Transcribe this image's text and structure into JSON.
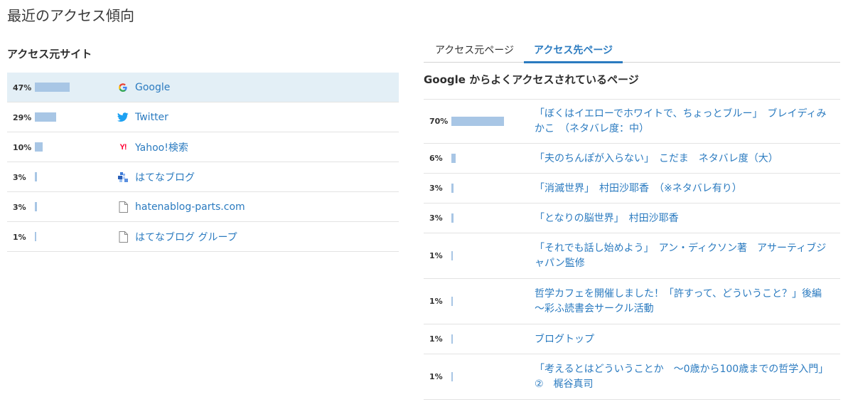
{
  "page_title": "最近のアクセス傾向",
  "left": {
    "title": "アクセス元サイト",
    "rows": [
      {
        "pct": "47%",
        "ratio": 0.47,
        "icon": "google-icon",
        "name": "Google"
      },
      {
        "pct": "29%",
        "ratio": 0.29,
        "icon": "twitter-icon",
        "name": "Twitter"
      },
      {
        "pct": "10%",
        "ratio": 0.1,
        "icon": "yahoo-icon",
        "name": "Yahoo!検索"
      },
      {
        "pct": "3%",
        "ratio": 0.03,
        "icon": "hatena-blog-icon",
        "name": "はてなブログ"
      },
      {
        "pct": "3%",
        "ratio": 0.03,
        "icon": "document-icon",
        "name": "hatenablog-parts.com"
      },
      {
        "pct": "1%",
        "ratio": 0.01,
        "icon": "document-icon",
        "name": "はてなブログ グループ"
      }
    ]
  },
  "right": {
    "tabs": [
      {
        "label": "アクセス元ページ",
        "active": false
      },
      {
        "label": "アクセス先ページ",
        "active": true
      }
    ],
    "subheading": "Google からよくアクセスされているページ",
    "rows": [
      {
        "pct": "70%",
        "ratio": 0.7,
        "title": "「ぼくはイエローでホワイトで、ちょっとブルー」　ブレイディみかこ　（ネタバレ度：中）"
      },
      {
        "pct": "6%",
        "ratio": 0.06,
        "title": "「夫のちんぽが入らない」　こだま　ネタバレ度（大）"
      },
      {
        "pct": "3%",
        "ratio": 0.03,
        "title": "「消滅世界」　村田沙耶香　（※ネタバレ有り）"
      },
      {
        "pct": "3%",
        "ratio": 0.03,
        "title": "「となりの脳世界」　村田沙耶香"
      },
      {
        "pct": "1%",
        "ratio": 0.01,
        "title": "「それでも話し始めよう」　アン・ディクソン著　アサーティブジャパン監修"
      },
      {
        "pct": "1%",
        "ratio": 0.01,
        "title": "哲学カフェを開催しました！「許すって、どういうこと？」後編　～彩ふ読書会サークル活動"
      },
      {
        "pct": "1%",
        "ratio": 0.01,
        "title": "ブログトップ"
      },
      {
        "pct": "1%",
        "ratio": 0.01,
        "title": "「考えるとはどういうことか　～0歳から100歳までの哲学入門」　②　梶谷真司"
      }
    ]
  },
  "colors": {
    "link": "#2b7bc0",
    "bar": "#a8c6e5",
    "highlight": "#e3eff6"
  }
}
